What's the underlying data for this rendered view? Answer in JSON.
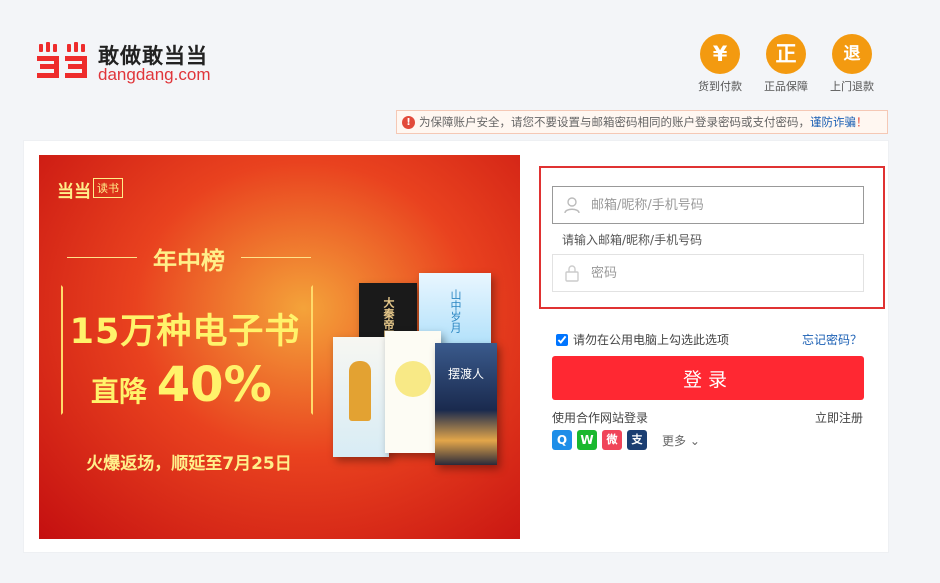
{
  "header": {
    "logo_slogan": "敢做敢当当",
    "logo_domain": "dangdang.com",
    "promises": [
      {
        "icon": "yuan-icon",
        "glyph": "¥",
        "label": "货到付款"
      },
      {
        "icon": "genuine-icon",
        "glyph": "正",
        "label": "正品保障"
      },
      {
        "icon": "return-icon",
        "glyph": "退",
        "label": "上门退款"
      }
    ]
  },
  "notice": {
    "text": "为保障账户安全，请您不要设置与邮箱密码相同的账户登录密码或支付密码，",
    "link": "谨防诈骗",
    "suffix": "！"
  },
  "banner": {
    "logo_mark": "当当",
    "logo_tag": "读书",
    "subtitle": "年中榜",
    "headline": "15万种电子书",
    "discount_prefix": "直降",
    "discount_value": "40%",
    "footer": "火爆返场，顺延至7月25日",
    "book_titles": [
      "大秦帝国",
      "山中岁月",
      "摆渡人"
    ]
  },
  "login": {
    "username_placeholder": "邮箱/昵称/手机号码",
    "username_value": "",
    "username_hint": "请输入邮箱/昵称/手机号码",
    "password_placeholder": "密码",
    "remember_label": "请勿在公用电脑上勾选此选项",
    "remember_checked": true,
    "forgot_label": "忘记密码？",
    "submit_label": "登录",
    "partner_label": "使用合作网站登录",
    "register_label": "立即注册",
    "more_label": "更多",
    "socials": [
      {
        "icon": "qq-icon",
        "glyph": "Q",
        "color": "#1e8ee8"
      },
      {
        "icon": "wechat-icon",
        "glyph": "W",
        "color": "#1ab82e"
      },
      {
        "icon": "weibo-icon",
        "glyph": "微",
        "color": "#f0455a"
      },
      {
        "icon": "alipay-icon",
        "glyph": "支",
        "color": "#1b3e72"
      }
    ]
  },
  "colors": {
    "brand_red": "#ff2832",
    "promise_orange": "#f39a10",
    "link_blue": "#1a5fb4",
    "highlight_border": "#e03232"
  }
}
